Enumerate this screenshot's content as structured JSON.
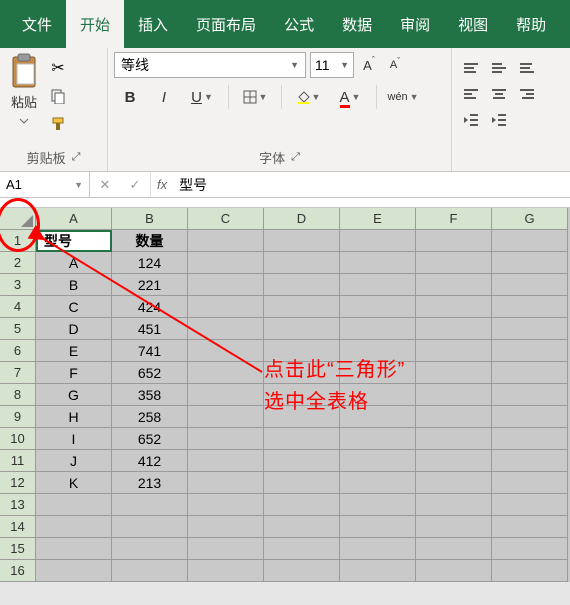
{
  "tabs": [
    "文件",
    "开始",
    "插入",
    "页面布局",
    "公式",
    "数据",
    "审阅",
    "视图",
    "帮助"
  ],
  "active_tab_index": 1,
  "clipboard": {
    "paste_label": "粘贴",
    "group_label": "剪贴板"
  },
  "font": {
    "group_label": "字体",
    "name": "等线",
    "size": "11",
    "increase": "A",
    "decrease": "A",
    "bold": "B",
    "italic": "I",
    "underline": "U",
    "wen": "wén"
  },
  "name_box": "A1",
  "fx_label": "fx",
  "formula_value": "型号",
  "columns": [
    "A",
    "B",
    "C",
    "D",
    "E",
    "F",
    "G"
  ],
  "row_numbers": [
    1,
    2,
    3,
    4,
    5,
    6,
    7,
    8,
    9,
    10,
    11,
    12,
    13,
    14,
    15,
    16
  ],
  "table": {
    "headers": [
      "型号",
      "数量"
    ],
    "rows": [
      [
        "A",
        "124"
      ],
      [
        "B",
        "221"
      ],
      [
        "C",
        "424"
      ],
      [
        "D",
        "451"
      ],
      [
        "E",
        "741"
      ],
      [
        "F",
        "652"
      ],
      [
        "G",
        "358"
      ],
      [
        "H",
        "258"
      ],
      [
        "I",
        "652"
      ],
      [
        "J",
        "412"
      ],
      [
        "K",
        "213"
      ]
    ]
  },
  "annotation": {
    "line1": "点击此“三角形”",
    "line2": "选中全表格"
  }
}
